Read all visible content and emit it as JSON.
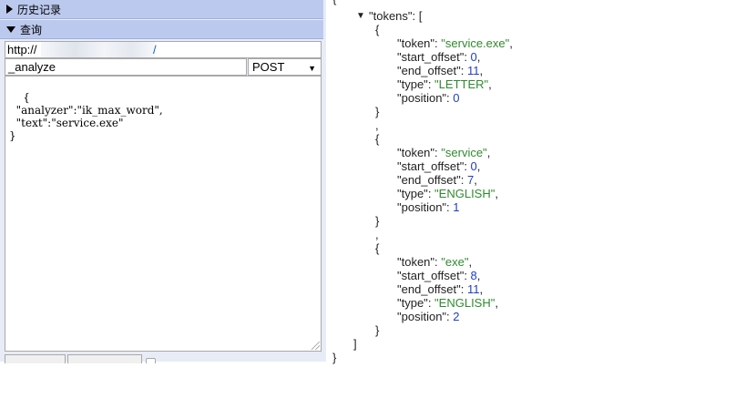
{
  "panel": {
    "history_label": "历史记录",
    "query_label": "查询",
    "url_prefix": "http://",
    "url_suffix": "/",
    "path_value": "_analyze",
    "method_value": "POST",
    "request_body": "{\n  \"analyzer\":\"ik_max_word\",\n  \"text\":\"service.exe\"\n}"
  },
  "response": {
    "open_brace": "{",
    "tokens_key": "\"tokens\"",
    "colon_bracket": ": [",
    "close_bracket": "]",
    "close_brace": "}",
    "item_open": "{",
    "item_close": "}",
    "separator": ",",
    "keys": {
      "token": "\"token\"",
      "start_offset": "\"start_offset\"",
      "end_offset": "\"end_offset\"",
      "type": "\"type\"",
      "position": "\"position\""
    },
    "tokens": [
      {
        "token": "\"service.exe\"",
        "start_offset": "0",
        "end_offset": "11",
        "type": "\"LETTER\"",
        "position": "0"
      },
      {
        "token": "\"service\"",
        "start_offset": "0",
        "end_offset": "7",
        "type": "\"ENGLISH\"",
        "position": "1"
      },
      {
        "token": "\"exe\"",
        "start_offset": "8",
        "end_offset": "11",
        "type": "\"ENGLISH\"",
        "position": "2"
      }
    ]
  },
  "colors": {
    "header_bg": "#bcc9ef",
    "panel_bg": "#e7ecf6",
    "string_color": "#2f8a2f",
    "number_color": "#1f3fc8"
  }
}
